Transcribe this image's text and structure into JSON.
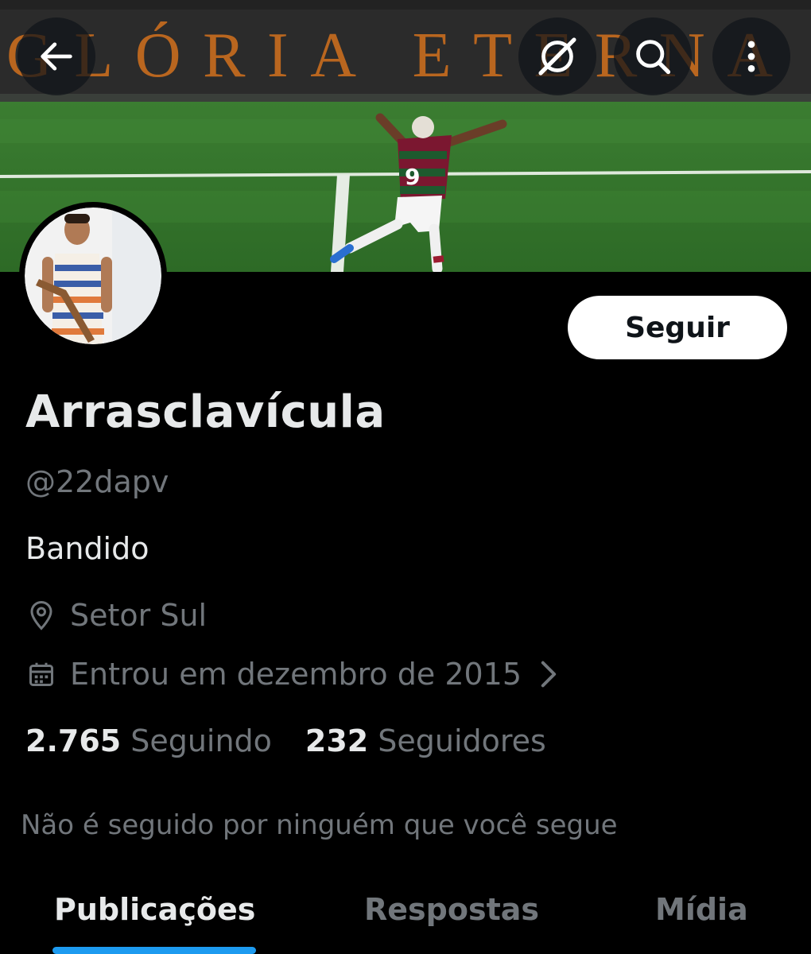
{
  "banner": {
    "stadium_text": "GLÓRIA ETERNA",
    "player_number": "9"
  },
  "header": {
    "back_icon": "arrow-left-icon",
    "grok_icon": "grok-icon",
    "search_icon": "search-icon",
    "more_icon": "more-vertical-icon"
  },
  "profile": {
    "display_name": "Arrasclavícula",
    "handle": "@22dapv",
    "bio": "Bandido",
    "location": "Setor Sul",
    "joined": "Entrou em dezembro de 2015",
    "follow_label": "Seguir",
    "following_count": "2.765",
    "following_label": "Seguindo",
    "followers_count": "232",
    "followers_label": "Seguidores",
    "mutuals_text": "Não é seguido por ninguém que você segue"
  },
  "tabs": [
    {
      "label": "Publicações",
      "active": true
    },
    {
      "label": "Respostas",
      "active": false
    },
    {
      "label": "Mídia",
      "active": false
    }
  ],
  "colors": {
    "background": "#000000",
    "primary_text": "#e7e9ea",
    "secondary_text": "#71767b",
    "accent": "#1d9bf0",
    "follow_button_bg": "#ffffff"
  }
}
